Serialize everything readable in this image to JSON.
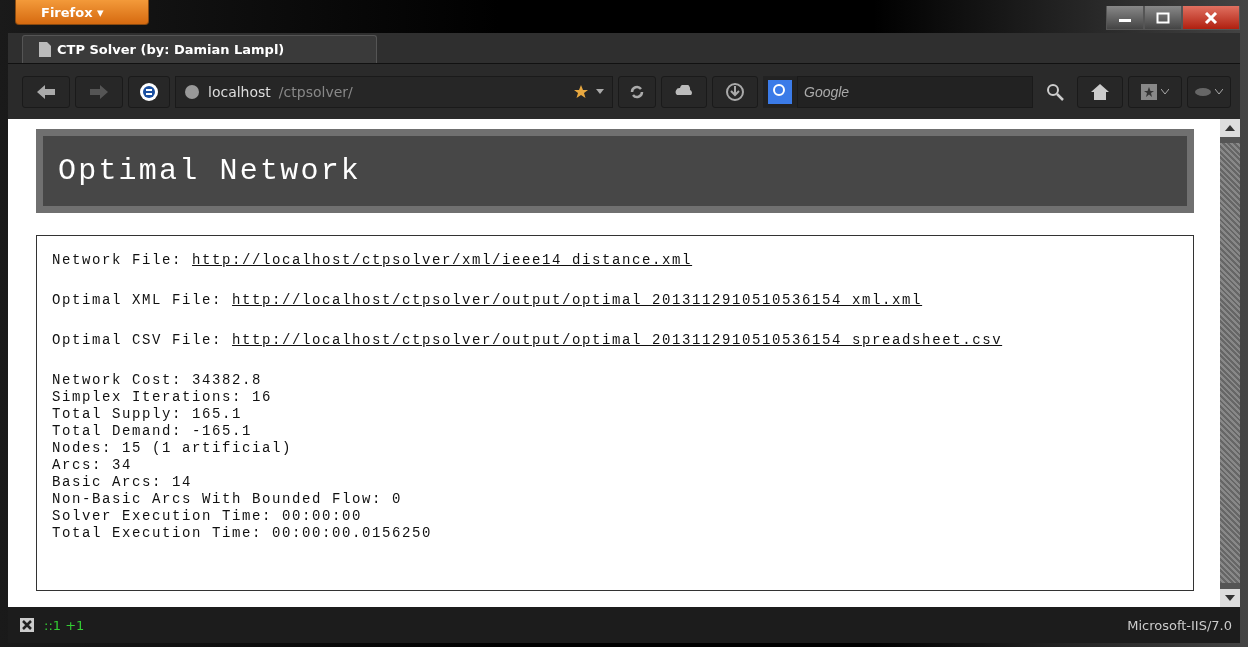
{
  "window": {
    "menu_button": "Firefox ▾"
  },
  "tabs": [
    {
      "title": "CTP Solver (by: Damian Lampl)",
      "selected": true
    }
  ],
  "toolbar": {
    "address_host": "localhost",
    "address_path": "/ctpsolver/",
    "search_placeholder": "Google"
  },
  "page": {
    "heading": "Optimal Network",
    "links": [
      {
        "label": "Network File: ",
        "url": "http://localhost/ctpsolver/xml/ieee14_distance.xml"
      },
      {
        "label": "Optimal XML File: ",
        "url": "http://localhost/ctpsolver/output/optimal_2013112910510536154_xml.xml"
      },
      {
        "label": "Optimal CSV File: ",
        "url": "http://localhost/ctpsolver/output/optimal_2013112910510536154_spreadsheet.csv"
      }
    ],
    "stats": [
      "Network Cost: 34382.8",
      "Simplex Iterations: 16",
      "Total Supply: 165.1",
      "Total Demand: -165.1",
      "Nodes: 15 (1 artificial)",
      "Arcs: 34",
      "Basic Arcs: 14",
      "Non-Basic Arcs With Bounded Flow: 0",
      "Solver Execution Time: 00:00:00",
      "Total Execution Time: 00:00:00.0156250"
    ]
  },
  "status_bar": {
    "addon_text": "::1 +1",
    "server": "Microsoft-IIS/7.0"
  }
}
